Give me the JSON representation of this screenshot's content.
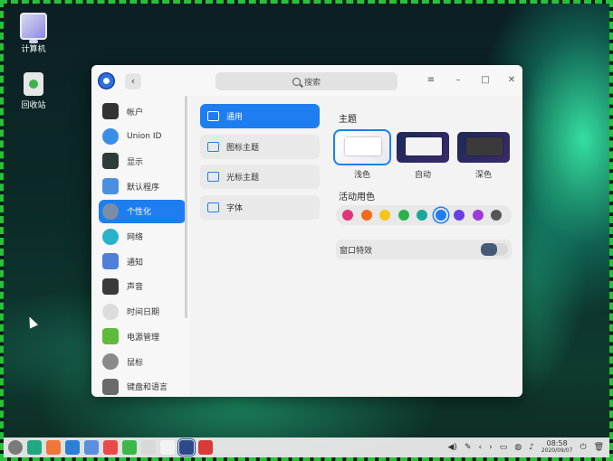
{
  "desktop": {
    "icons": [
      {
        "label": "计算机",
        "icon": "computer-icon"
      },
      {
        "label": "回收站",
        "icon": "trash-icon"
      }
    ]
  },
  "window": {
    "search_placeholder": "搜索",
    "buttons": [
      "menu",
      "minimize",
      "maximize",
      "close"
    ],
    "back_symbol": "‹",
    "menu_symbol": "≡",
    "min_symbol": "–",
    "max_symbol": "□",
    "close_symbol": "✕"
  },
  "nav": {
    "items": [
      {
        "label": "帐户",
        "icon": "account-icon",
        "color": "#333333"
      },
      {
        "label": "Union ID",
        "icon": "cloud-icon",
        "color": "#3a8ee6"
      },
      {
        "label": "显示",
        "icon": "display-icon",
        "color": "#2d3b3a"
      },
      {
        "label": "默认程序",
        "icon": "default-apps-icon",
        "color": "#4a8fe0"
      },
      {
        "label": "个性化",
        "icon": "personalization-icon",
        "color": "#7a8ea8",
        "active": true
      },
      {
        "label": "网络",
        "icon": "network-icon",
        "color": "#28b3c8"
      },
      {
        "label": "通知",
        "icon": "notification-icon",
        "color": "#4f7fd8"
      },
      {
        "label": "声音",
        "icon": "sound-icon",
        "color": "#3a3a3a"
      },
      {
        "label": "时间日期",
        "icon": "clock-icon",
        "color": "#dcdcdc"
      },
      {
        "label": "电源管理",
        "icon": "power-icon",
        "color": "#5fba3a"
      },
      {
        "label": "鼠标",
        "icon": "mouse-icon",
        "color": "#8a8a8a"
      },
      {
        "label": "键盘和语言",
        "icon": "keyboard-icon",
        "color": "#6a6a6a"
      }
    ]
  },
  "mid": {
    "items": [
      {
        "label": "通用",
        "icon": "general-icon",
        "active": true
      },
      {
        "label": "图标主题",
        "icon": "icon-theme-icon"
      },
      {
        "label": "光标主题",
        "icon": "cursor-theme-icon"
      },
      {
        "label": "字体",
        "icon": "font-icon"
      }
    ]
  },
  "right": {
    "theme_title": "主题",
    "themes": [
      {
        "label": "浅色",
        "selected": true
      },
      {
        "label": "自动"
      },
      {
        "label": "深色"
      }
    ],
    "accent_title": "活动用色",
    "accent_colors": [
      "#e0337a",
      "#f36b1c",
      "#f5c518",
      "#29b34a",
      "#18a89a",
      "#1e7ef0",
      "#6a3ee0",
      "#9b3ad6",
      "#555555"
    ],
    "selected_accent_index": 5,
    "window_effects_label": "窗口特效",
    "window_effects_on": false
  },
  "taskbar": {
    "apps": [
      {
        "icon": "launcher-icon",
        "color": "#7a7a7a"
      },
      {
        "icon": "multitask-icon",
        "color": "#22a880"
      },
      {
        "icon": "file-manager-icon",
        "color": "#f0763a"
      },
      {
        "icon": "app-store-icon",
        "color": "#2b7fd8"
      },
      {
        "icon": "browser-icon",
        "color": "#5a8fe0"
      },
      {
        "icon": "photos-icon",
        "color": "#e84a4a"
      },
      {
        "icon": "music-icon",
        "color": "#3ab84a"
      },
      {
        "icon": "document-icon",
        "color": "#d8d8d8"
      },
      {
        "icon": "calendar-icon",
        "color": "#f2f2f2"
      },
      {
        "icon": "control-center-icon",
        "color": "#2b4a8a"
      },
      {
        "icon": "screenshot-icon",
        "color": "#d83a3a"
      }
    ],
    "time": "08:58",
    "date": "2020/09/07"
  }
}
